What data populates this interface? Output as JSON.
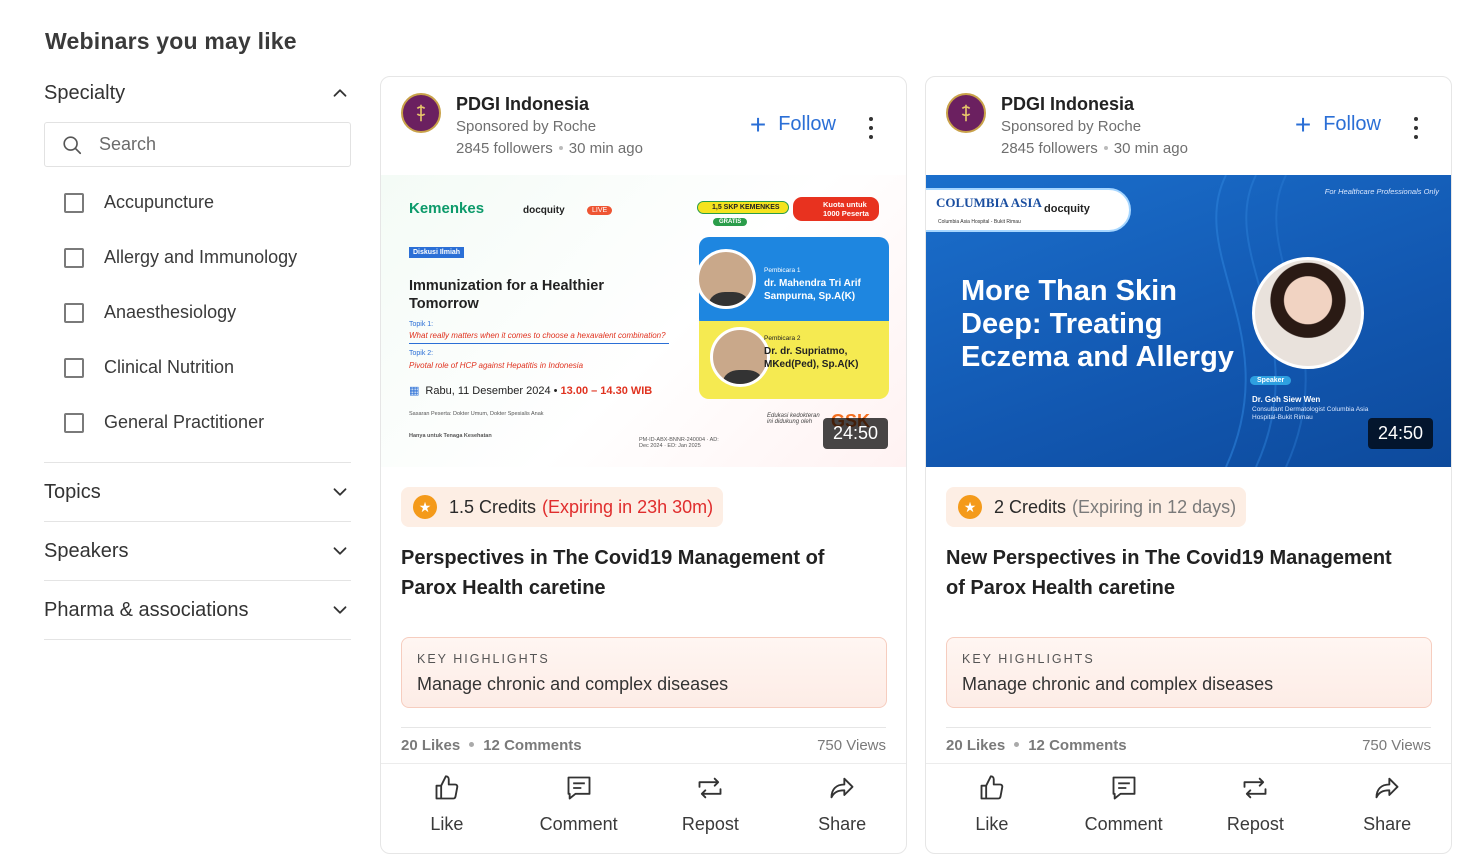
{
  "page_title": "Webinars you may like",
  "sidebar": {
    "specialty_label": "Specialty",
    "search_placeholder": "Search",
    "specialties": [
      "Accupuncture",
      "Allergy and Immunology",
      "Anaesthesiology",
      "Clinical Nutrition",
      "General Practitioner"
    ],
    "topics_label": "Topics",
    "speakers_label": "Speakers",
    "pharma_label": "Pharma & associations"
  },
  "cards": [
    {
      "org": "PDGI Indonesia",
      "sponsor": "Sponsored by Roche",
      "followers": "2845 followers",
      "posted": "30 min ago",
      "follow_label": "Follow",
      "duration": "24:50",
      "credits": "1.5 Credits",
      "expiry": "(Expiring in 23h 30m)",
      "expiry_color": "#e02d2d",
      "title": "Perspectives in The Covid19 Management of Parox Health caretine",
      "highlights_label": "KEY HIGHLIGHTS",
      "highlights_text": "Manage chronic and complex diseases",
      "likes": "20 Likes",
      "comments": "12 Comments",
      "views": "750 Views",
      "banner": {
        "brand": "Kemenkes",
        "partner": "docquity",
        "live": "LIVE",
        "skp": "1,5 SKP KEMENKES",
        "gratis": "GRATIS",
        "kuota": "Kuota untuk 1000 Peserta",
        "tag": "Diskusi Ilmiah",
        "title": "Immunization for a Healthier Tomorrow",
        "topic1_label": "Topik 1:",
        "topic1": "What really matters when it comes to choose a hexavalent combination?",
        "topic2_label": "Topik 2:",
        "topic2": "Pivotal role of HCP against Hepatitis in Indonesia",
        "date": "Rabu, 11 Desember 2024",
        "time": "13.00 – 14.30 WIB",
        "audience": "Sasaran Peserta: Dokter Umum, Dokter Spesialis Anak",
        "note": "Hanya untuk Tenaga Kesehatan",
        "code": "PM-ID-ABX-BNNR-240004 · AD: Dec 2024 · ED: Jan 2025",
        "speaker1_label": "Pembicara 1",
        "speaker1": "dr. Mahendra Tri Arif Sampurna, Sp.A(K)",
        "speaker2_label": "Pembicara 2",
        "speaker2": "Dr. dr. Supriatmo, MKed(Ped), Sp.A(K)",
        "edu": "Edukasi kedokteran ini didukung oleh",
        "sponsor_logo": "GSK"
      }
    },
    {
      "org": "PDGI Indonesia",
      "sponsor": "Sponsored by Roche",
      "followers": "2845 followers",
      "posted": "30 min ago",
      "follow_label": "Follow",
      "duration": "24:50",
      "credits": "2 Credits",
      "expiry": "(Expiring in 12 days)",
      "expiry_color": "#7a7a7a",
      "title": "New Perspectives in The Covid19 Management of Parox Health caretine",
      "highlights_label": "KEY HIGHLIGHTS",
      "highlights_text": "Manage chronic and complex diseases",
      "likes": "20 Likes",
      "comments": "12 Comments",
      "views": "750 Views",
      "banner": {
        "brand": "COLUMBIA ASIA",
        "brand_sub": "Columbia Asia Hospital - Bukit Rimau",
        "partner": "docquity",
        "audience": "For Healthcare Professionals Only",
        "title": "More Than Skin Deep: Treating Eczema and Allergy",
        "speaker_label": "Speaker",
        "speaker": "Dr. Goh Siew Wen",
        "speaker_desc": "Consultant Dermatologist Columbia Asia Hospital-Bukit Rimau"
      }
    }
  ],
  "actions": [
    "Like",
    "Comment",
    "Repost",
    "Share"
  ]
}
